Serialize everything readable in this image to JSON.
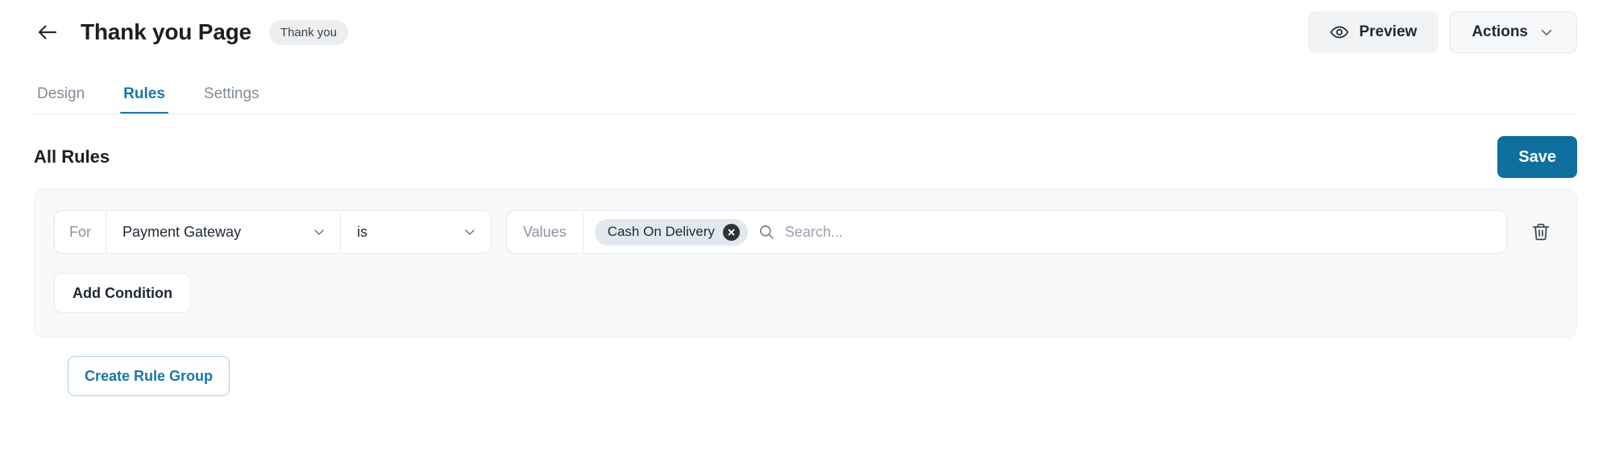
{
  "header": {
    "back_icon": "arrow-left-icon",
    "title": "Thank you Page",
    "badge": "Thank you",
    "preview_label": "Preview",
    "preview_icon": "eye-icon",
    "actions_label": "Actions",
    "actions_icon": "chevron-down-icon"
  },
  "tabs": [
    {
      "label": "Design",
      "active": false
    },
    {
      "label": "Rules",
      "active": true
    },
    {
      "label": "Settings",
      "active": false
    }
  ],
  "section": {
    "title": "All Rules",
    "save_label": "Save"
  },
  "rule_group": {
    "condition": {
      "for_label": "For",
      "field_value": "Payment Gateway",
      "operator_value": "is",
      "values_label": "Values",
      "chips": [
        {
          "label": "Cash On Delivery",
          "remove_icon": "close-circle-icon"
        }
      ],
      "search_icon": "search-icon",
      "search_value": "",
      "search_placeholder": "Search...",
      "delete_icon": "trash-icon"
    },
    "add_condition_label": "Add Condition"
  },
  "footer": {
    "create_rule_group_label": "Create Rule Group"
  },
  "colors": {
    "accent": "#1877ab",
    "primary_button": "#0f6f9e",
    "card_background": "#f8f9fb",
    "chip_background": "#e2e9ee",
    "badge_background": "#eceef0",
    "muted_text": "#8b949f"
  }
}
